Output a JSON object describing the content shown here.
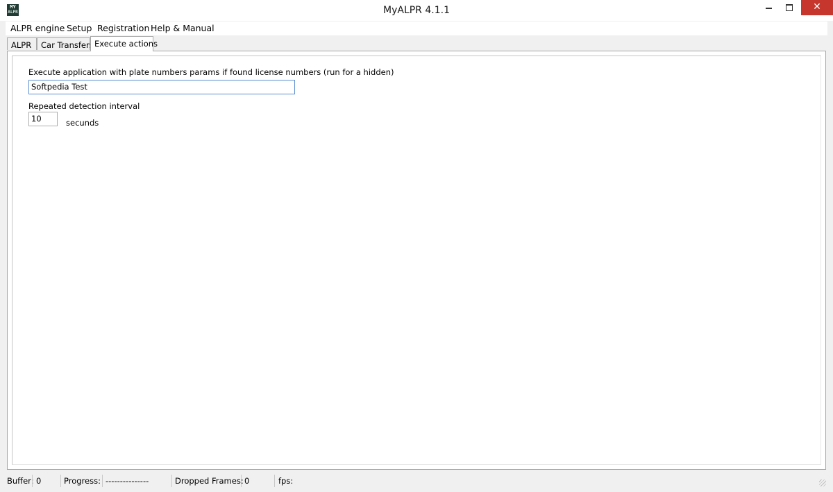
{
  "window": {
    "title": "MyALPR 4.1.1",
    "icon_text_top": "MY",
    "icon_text_bottom": "ALPR",
    "close_glyph": "✕"
  },
  "menu": {
    "items": [
      "ALPR engine",
      "Setup",
      "Registration",
      "Help & Manual"
    ]
  },
  "tabs": {
    "items": [
      "ALPR",
      "Car Transfers",
      "Execute actions"
    ],
    "active": "Execute actions"
  },
  "execute_actions": {
    "execute_label": "Execute application with plate numbers params if found license numbers (run for a hidden)",
    "execute_value": "Softpedia Test",
    "interval_label": "Repeated detection interval",
    "interval_value": "10",
    "interval_unit": "secunds"
  },
  "status": {
    "buffer_label": "Buffer:",
    "buffer_value": "0",
    "progress_label": "Progress:",
    "progress_value": "---------------",
    "dropped_label": "Dropped Frames:",
    "dropped_value": "0",
    "fps_label": "fps:",
    "fps_value": ""
  },
  "colors": {
    "close_button": "#c7362d",
    "focus_border": "#5b8fd0",
    "window_bg": "#f0f0f0"
  }
}
